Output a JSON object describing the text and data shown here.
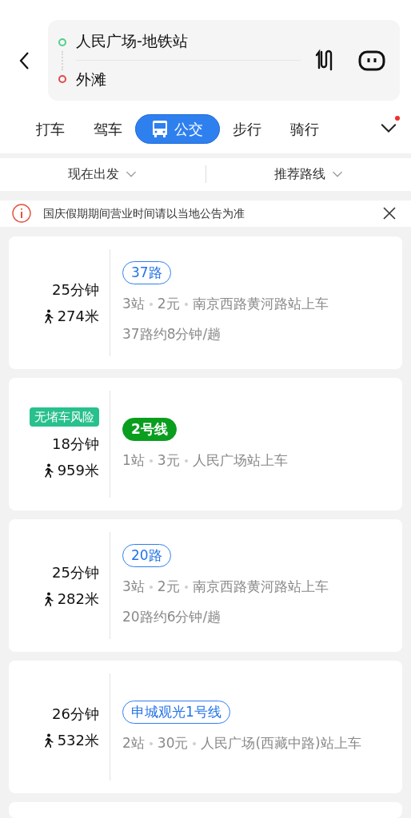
{
  "route": {
    "origin": "人民广场-地铁站",
    "destination": "外滩"
  },
  "modes": [
    {
      "label": "打车",
      "selected": false
    },
    {
      "label": "驾车",
      "selected": false
    },
    {
      "label": "公交",
      "selected": true
    },
    {
      "label": "步行",
      "selected": false
    },
    {
      "label": "骑行",
      "selected": false
    }
  ],
  "more_has_dot": true,
  "filters": [
    "现在出发",
    "推荐路线"
  ],
  "notice": "国庆假期期间营业时间请以当地公告为准",
  "plans": [
    {
      "duration": "25分钟",
      "walk": "274米",
      "line": {
        "name": "37路",
        "kind": "bus"
      },
      "info": [
        "3站",
        "2元",
        "南京西路黄河路站上车"
      ],
      "frequency": "37路约8分钟/趟"
    },
    {
      "badge": "无堵车风险",
      "duration": "18分钟",
      "walk": "959米",
      "line": {
        "name": "2号线",
        "kind": "subway"
      },
      "info": [
        "1站",
        "3元",
        "人民广场站上车"
      ]
    },
    {
      "duration": "25分钟",
      "walk": "282米",
      "line": {
        "name": "20路",
        "kind": "bus"
      },
      "info": [
        "3站",
        "2元",
        "南京西路黄河路站上车"
      ],
      "frequency": "20路约6分钟/趟"
    },
    {
      "duration": "26分钟",
      "walk": "532米",
      "line": {
        "name": "申城观光1号线",
        "kind": "bus"
      },
      "info": [
        "2站",
        "30元",
        "人民广场(西藏中路)站上车"
      ]
    }
  ]
}
